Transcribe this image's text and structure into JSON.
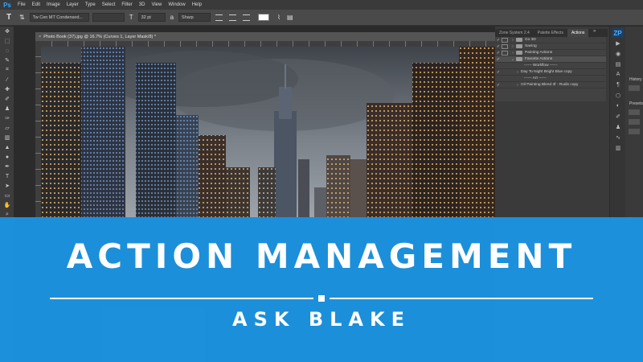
{
  "app": {
    "logo": "Ps",
    "menu": [
      "File",
      "Edit",
      "Image",
      "Layer",
      "Type",
      "Select",
      "Filter",
      "3D",
      "View",
      "Window",
      "Help"
    ]
  },
  "options_bar": {
    "tool_icon": "type-tool-icon",
    "font_family": "Tw Cen MT Condensed...",
    "font_size": "32 pt",
    "antialias": "Sharp",
    "text_color": "#ffffff"
  },
  "document": {
    "tab_title": "Photo Book (37).jpg @ 16.7% (Curves 1, Layer Mask/8) *",
    "close_glyph": "×"
  },
  "panels": {
    "tabs": [
      "Zone System 2.4",
      "Palette Effects",
      "Actions"
    ],
    "active_tab": "Actions",
    "collapse_glyph": "»",
    "actions": [
      {
        "check": "✓",
        "dialog": true,
        "toggle": "›",
        "label": "Go 3D",
        "folder": true
      },
      {
        "check": "✓",
        "dialog": true,
        "toggle": "›",
        "label": "Saving",
        "folder": true
      },
      {
        "check": "✓",
        "dialog": true,
        "toggle": "›",
        "label": "Painting Actions",
        "folder": true
      },
      {
        "check": "✓",
        "dialog": false,
        "toggle": "⌄",
        "label": "Favorite Actions",
        "folder": true,
        "selected": true
      },
      {
        "check": "",
        "dialog": false,
        "toggle": "",
        "label": "------ Workflow ------",
        "folder": false
      },
      {
        "check": "✓",
        "dialog": false,
        "toggle": "›",
        "label": "Day To Night Bright Blue copy",
        "folder": false
      },
      {
        "check": "",
        "dialog": false,
        "toggle": "",
        "label": "------ Art ------",
        "folder": false
      },
      {
        "check": "✓",
        "dialog": false,
        "toggle": "›",
        "label": "Oil Painting Blend 3f - Rudis copy",
        "folder": false
      }
    ],
    "history_label": "History",
    "presets_label": "Presets",
    "zp_badge": "ZP"
  },
  "banner": {
    "title": "ACTION MANAGEMENT",
    "subtitle": "ASK BLAKE",
    "color": "#1c96e6"
  }
}
